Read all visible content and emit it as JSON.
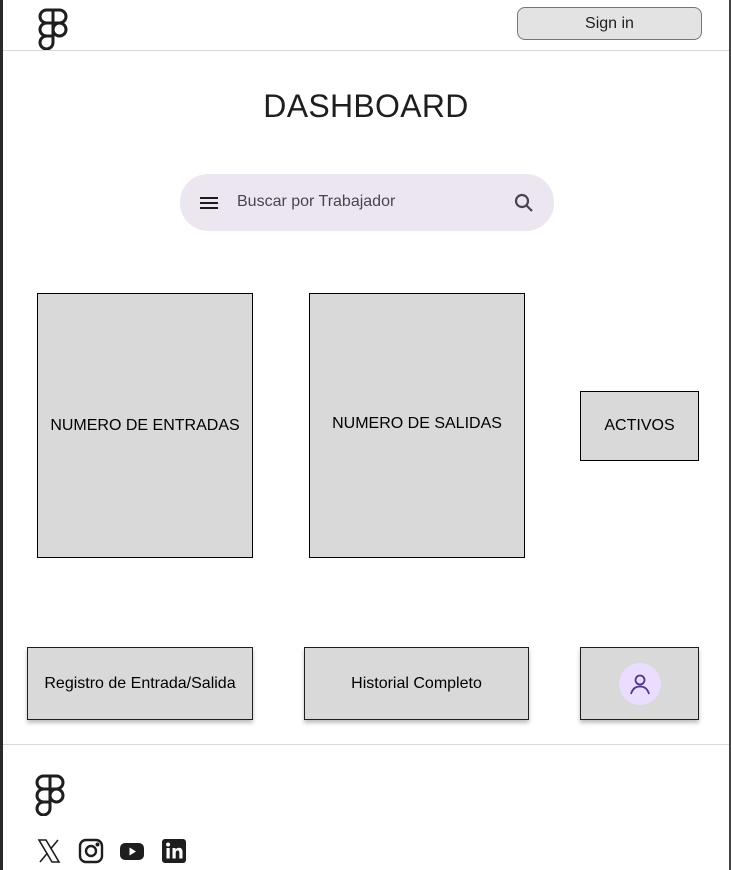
{
  "header": {
    "logo_icon": "figma-logo-icon",
    "signin_label": "Sign in"
  },
  "page": {
    "title": "DASHBOARD"
  },
  "search": {
    "menu_icon": "hamburger-menu-icon",
    "placeholder": "Buscar por Trabajador",
    "value": "",
    "search_icon": "search-icon"
  },
  "cards": {
    "entradas": "NUMERO DE ENTRADAS",
    "salidas": "NUMERO DE SALIDAS",
    "activos": "ACTIVOS"
  },
  "actions": {
    "registro": "Registro de Entrada/Salida",
    "historial": "Historial Completo",
    "perfil_icon": "user-avatar-icon"
  },
  "footer": {
    "logo_icon": "figma-logo-icon",
    "social": [
      "x-twitter-icon",
      "instagram-icon",
      "youtube-icon",
      "linkedin-icon"
    ]
  },
  "colors": {
    "search_bg": "#ece6f0",
    "card_bg": "#d9d9d9",
    "avatar_bg": "#eaddff",
    "button_bg": "#e3e3e3"
  }
}
